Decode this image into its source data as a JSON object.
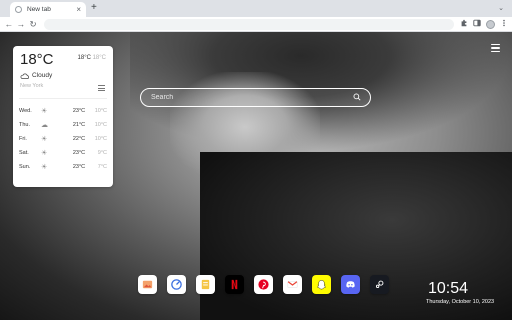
{
  "browser": {
    "tab_title": "New tab",
    "tab_close": "×",
    "new_tab": "+",
    "tab_search": "⌄",
    "back": "←",
    "forward": "→",
    "reload": "↻",
    "omnibox_value": "",
    "icons": [
      "extensions-icon",
      "sidepanel-icon",
      "profile-avatar",
      "kebab-menu-icon"
    ]
  },
  "weather": {
    "temp": "18°C",
    "condition": "Cloudy",
    "city": "New York",
    "high": "18°C",
    "low": "18°C",
    "forecast": [
      {
        "day": "Wed.",
        "icon": "sun-icon",
        "high": "23°C",
        "low": "10°C"
      },
      {
        "day": "Thu.",
        "icon": "cloud-icon",
        "high": "21°C",
        "low": "10°C"
      },
      {
        "day": "Fri.",
        "icon": "sun-icon",
        "high": "22°C",
        "low": "10°C"
      },
      {
        "day": "Sat.",
        "icon": "sun-icon",
        "high": "23°C",
        "low": "9°C"
      },
      {
        "day": "Sun.",
        "icon": "sun-icon",
        "high": "23°C",
        "low": "7°C"
      }
    ]
  },
  "search": {
    "placeholder": "Search"
  },
  "dock": {
    "apps": [
      {
        "name": "photos-app",
        "icon": "image-icon",
        "color": "#ffffff"
      },
      {
        "name": "performance-app",
        "icon": "gauge-icon",
        "color": "#ffffff"
      },
      {
        "name": "notes-app",
        "icon": "note-icon",
        "color": "#ffffff"
      },
      {
        "name": "netflix-app",
        "icon": "netflix-icon",
        "color": "#000000"
      },
      {
        "name": "pinterest-app",
        "icon": "pinterest-icon",
        "color": "#ffffff"
      },
      {
        "name": "gmail-app",
        "icon": "gmail-icon",
        "color": "#ffffff"
      },
      {
        "name": "snapchat-app",
        "icon": "snapchat-icon",
        "color": "#fffc00"
      },
      {
        "name": "discord-app",
        "icon": "discord-icon",
        "color": "#5865f2"
      },
      {
        "name": "steam-app",
        "icon": "steam-icon",
        "color": "#171a21"
      }
    ]
  },
  "clock": {
    "time": "10:54",
    "date": "Thursday, October 10, 2023"
  }
}
